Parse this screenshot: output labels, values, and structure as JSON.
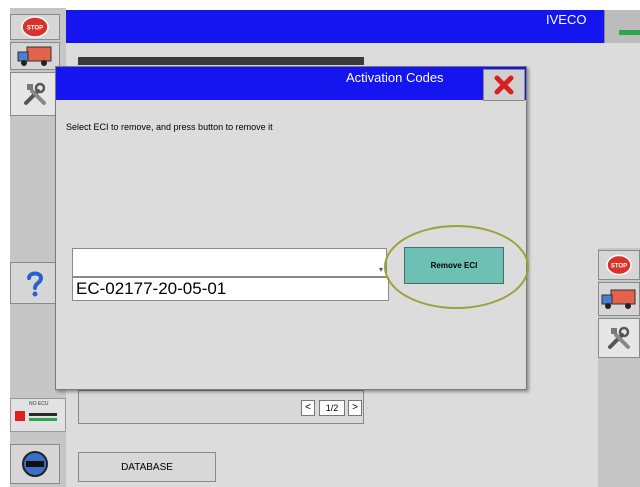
{
  "app": {
    "brand": "IVECO"
  },
  "left_rail": {
    "items": [
      {
        "name": "stop-button",
        "label": "STOP",
        "icon": "stop-icon"
      },
      {
        "name": "truck-button",
        "icon": "truck-icon"
      },
      {
        "name": "tools-button",
        "icon": "tools-icon"
      },
      {
        "name": "help-button",
        "icon": "question-icon"
      }
    ],
    "ecu_label": "NO ECU",
    "power_icon": "connector-icon"
  },
  "right_rail": {
    "items": [
      {
        "name": "stop-button",
        "label": "STOP",
        "icon": "stop-icon"
      },
      {
        "name": "truck-button",
        "icon": "truck-icon"
      },
      {
        "name": "tools-button",
        "icon": "tools-icon"
      }
    ]
  },
  "pager": {
    "prev": "<",
    "page_indicator": "1/2",
    "next": ">"
  },
  "bottom": {
    "database_label": "DATABASE"
  },
  "dialog": {
    "title": "Activation Codes",
    "close_icon": "red-x-icon",
    "instruction": "Select ECI to remove, and press button to remove it",
    "select_value": "",
    "eci_value": "EC-02177-20-05-01",
    "remove_label": "Remove ECI"
  },
  "colors": {
    "title_blue": "#1515f0",
    "remove_button": "#6cc0b4",
    "highlight_ring": "#9aa23a",
    "stop_red": "#d8322a"
  }
}
